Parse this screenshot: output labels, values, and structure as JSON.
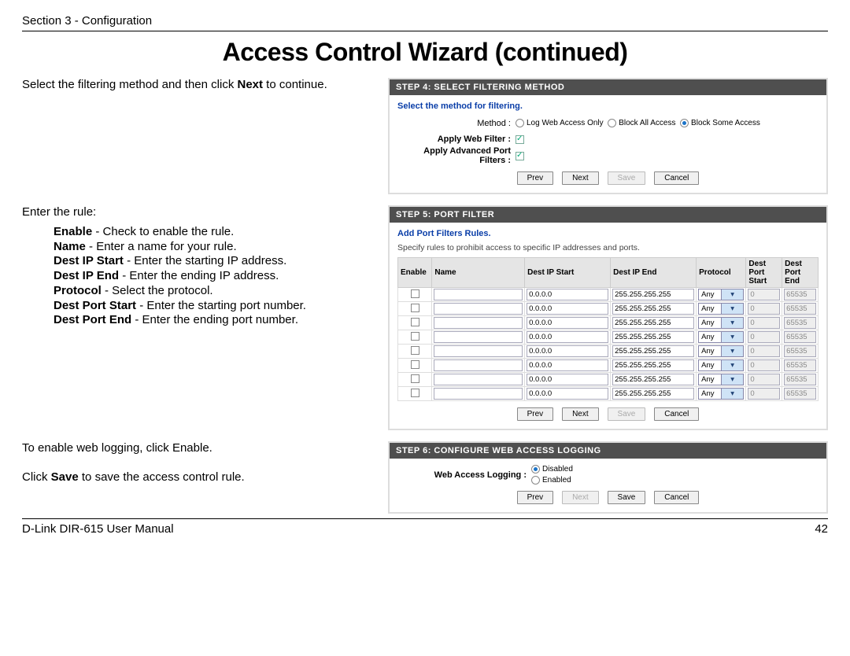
{
  "header": {
    "section": "Section 3 - Configuration"
  },
  "title": "Access Control Wizard (continued)",
  "step4": {
    "header": "STEP 4: SELECT FILTERING METHOD",
    "prompt": "Select the method for filtering.",
    "method_label": "Method :",
    "opt1": "Log Web Access Only",
    "opt2": "Block All Access",
    "opt3": "Block Some Access",
    "awf_label": "Apply Web Filter :",
    "aapf_label": "Apply Advanced Port Filters :",
    "btn_prev": "Prev",
    "btn_next": "Next",
    "btn_save": "Save",
    "btn_cancel": "Cancel",
    "left_text_a": "Select the filtering method and then click ",
    "left_bold": "Next",
    "left_text_b": " to continue."
  },
  "step5": {
    "header": "STEP 5: PORT FILTER",
    "title": "Add Port Filters Rules.",
    "subtitle": "Specify rules to prohibit access to specific IP addresses and ports.",
    "cols": {
      "enable": "Enable",
      "name": "Name",
      "ips": "Dest IP Start",
      "ipe": "Dest IP End",
      "proto": "Protocol",
      "ps": "Dest Port Start",
      "pe": "Dest Port End"
    },
    "row": {
      "ips": "0.0.0.0",
      "ipe": "255.255.255.255",
      "proto": "Any",
      "ps": "0",
      "pe": "65535"
    },
    "btn_prev": "Prev",
    "btn_next": "Next",
    "btn_save": "Save",
    "btn_cancel": "Cancel",
    "left_intro": "Enter the rule:",
    "defs": {
      "enable_t": "Enable",
      "enable_d": " - Check to enable the rule.",
      "name_t": "Name",
      "name_d": " - Enter a name for your rule.",
      "dis_t": "Dest IP Start",
      "dis_d": " - Enter the starting IP address.",
      "die_t": "Dest IP End",
      "die_d": " - Enter the ending IP address.",
      "proto_t": "Protocol",
      "proto_d": " - Select the protocol.",
      "dps_t": "Dest Port Start",
      "dps_d": " - Enter the starting port number.",
      "dpe_t": "Dest Port End",
      "dpe_d": " - Enter the ending port number."
    }
  },
  "step6": {
    "header": "STEP 6: CONFIGURE WEB ACCESS LOGGING",
    "label": "Web Access Logging :",
    "opt1": "Disabled",
    "opt2": "Enabled",
    "btn_prev": "Prev",
    "btn_next": "Next",
    "btn_save": "Save",
    "btn_cancel": "Cancel",
    "left1": "To enable web logging, click Enable.",
    "left2a": "Click ",
    "left2b": "Save",
    "left2c": " to save the access control rule."
  },
  "footer": {
    "left": "D-Link DIR-615 User Manual",
    "page": "42"
  }
}
